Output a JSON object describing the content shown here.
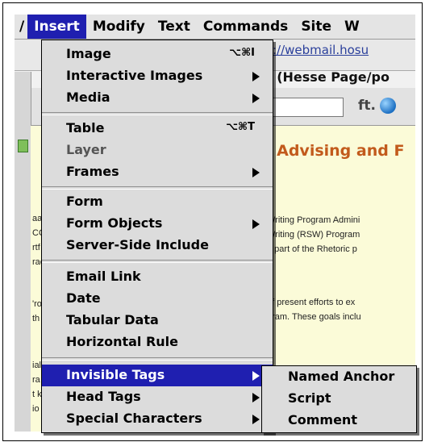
{
  "menubar": {
    "items": [
      "/",
      "Insert",
      "Modify",
      "Text",
      "Commands",
      "Site",
      "W"
    ]
  },
  "background": {
    "url": "://webmail.hosu",
    "title": "t (Hesse Page/po",
    "heading": "l Advising and F",
    "toolbar_icon": "ft.",
    "body_lines": [
      "Writing Program Admini",
      "Writing (RSW) Program",
      "e part of the Rhetoric p",
      "of present efforts to ex",
      "gram. These goals inclu"
    ],
    "left_fragments": [
      "aa",
      "CC",
      "rtf",
      "rac",
      "'ro",
      "th",
      "ial",
      "ra",
      "t k",
      "io"
    ]
  },
  "menu": {
    "items": [
      {
        "label": "Image",
        "shortcut": "⌥⌘I"
      },
      {
        "label": "Interactive Images"
      },
      {
        "label": "Media"
      },
      {
        "label": "Table",
        "shortcut": "⌥⌘T"
      },
      {
        "label": "Layer"
      },
      {
        "label": "Frames"
      },
      {
        "label": "Form"
      },
      {
        "label": "Form Objects"
      },
      {
        "label": "Server-Side Include"
      },
      {
        "label": "Email Link"
      },
      {
        "label": "Date"
      },
      {
        "label": "Tabular Data"
      },
      {
        "label": "Horizontal Rule"
      },
      {
        "label": "Invisible Tags"
      },
      {
        "label": "Head Tags"
      },
      {
        "label": "Special Characters"
      }
    ]
  },
  "submenu": {
    "items": [
      {
        "label": "Named Anchor"
      },
      {
        "label": "Script"
      },
      {
        "label": "Comment"
      }
    ]
  },
  "colors": {
    "highlight": "#1f1fb0",
    "menu_bg": "#dcdcdc",
    "page_bg": "#fbfbd8",
    "heading": "#c25a1c"
  }
}
